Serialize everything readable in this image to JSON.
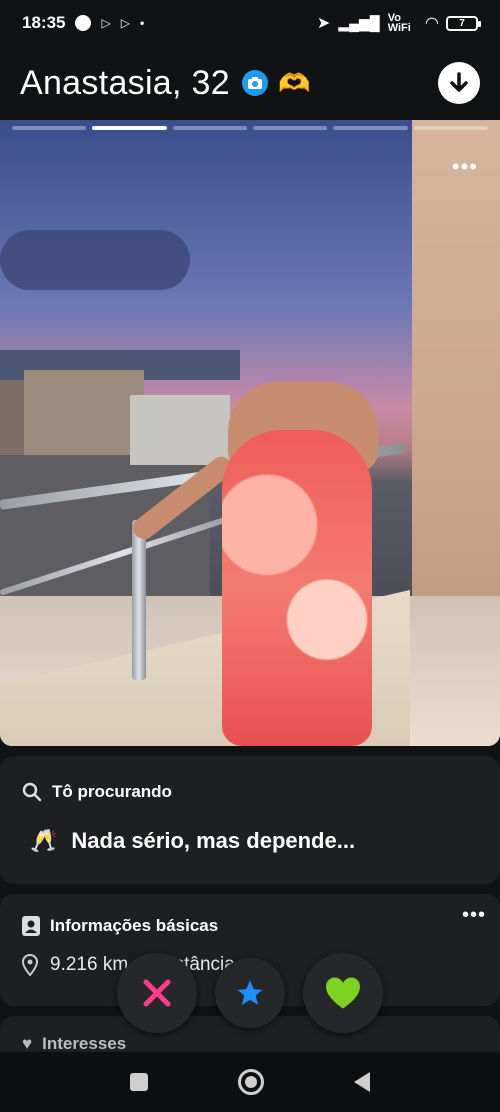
{
  "status_bar": {
    "time": "18:35",
    "network_label": "Vo WiFi",
    "battery": "7"
  },
  "profile": {
    "name_age": "Anastasia, 32",
    "verified_icon": "camera-verified-icon",
    "badge_icon": "heart-hand-icon",
    "download_icon": "arrow-down-icon"
  },
  "photo": {
    "total_photos": 6,
    "active_index": 1,
    "more_label": "•••"
  },
  "looking_for": {
    "title": "Tô procurando",
    "emoji": "🥂",
    "value": "Nada sério, mas depende..."
  },
  "basic_info": {
    "title": "Informações básicas",
    "distance": "9.216 km de distância",
    "more_label": "•••"
  },
  "interests": {
    "title": "Interesses"
  },
  "actions": {
    "nope_icon": "x-icon",
    "super_like_icon": "star-icon",
    "like_icon": "heart-icon",
    "colors": {
      "nope": "#ff3b8d",
      "super_like": "#1e90ff",
      "like": "#7ed321"
    }
  }
}
